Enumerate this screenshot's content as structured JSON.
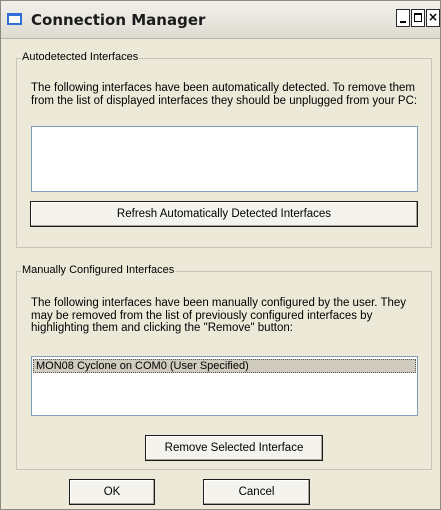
{
  "window": {
    "title": "Connection Manager",
    "controls": {
      "minimize": "_",
      "maximize": "□",
      "close": "×"
    }
  },
  "autodetected": {
    "legend": "Autodetected Interfaces",
    "description": "The following interfaces have been automatically detected. To remove them from the list of displayed interfaces they should be unplugged from your PC:",
    "items": [],
    "refresh_label": "Refresh Automatically Detected Interfaces"
  },
  "manual": {
    "legend": "Manually Configured Interfaces",
    "description": "The following interfaces have been manually configured by the user. They may be removed from the list of previously configured interfaces by highlighting them and clicking the \"Remove\" button:",
    "items": [
      {
        "label": "MON08 Cyclone on COM0 (User Specified)",
        "selected": true
      }
    ],
    "remove_label": "Remove Selected Interface"
  },
  "footer": {
    "ok_label": "OK",
    "cancel_label": "Cancel"
  }
}
